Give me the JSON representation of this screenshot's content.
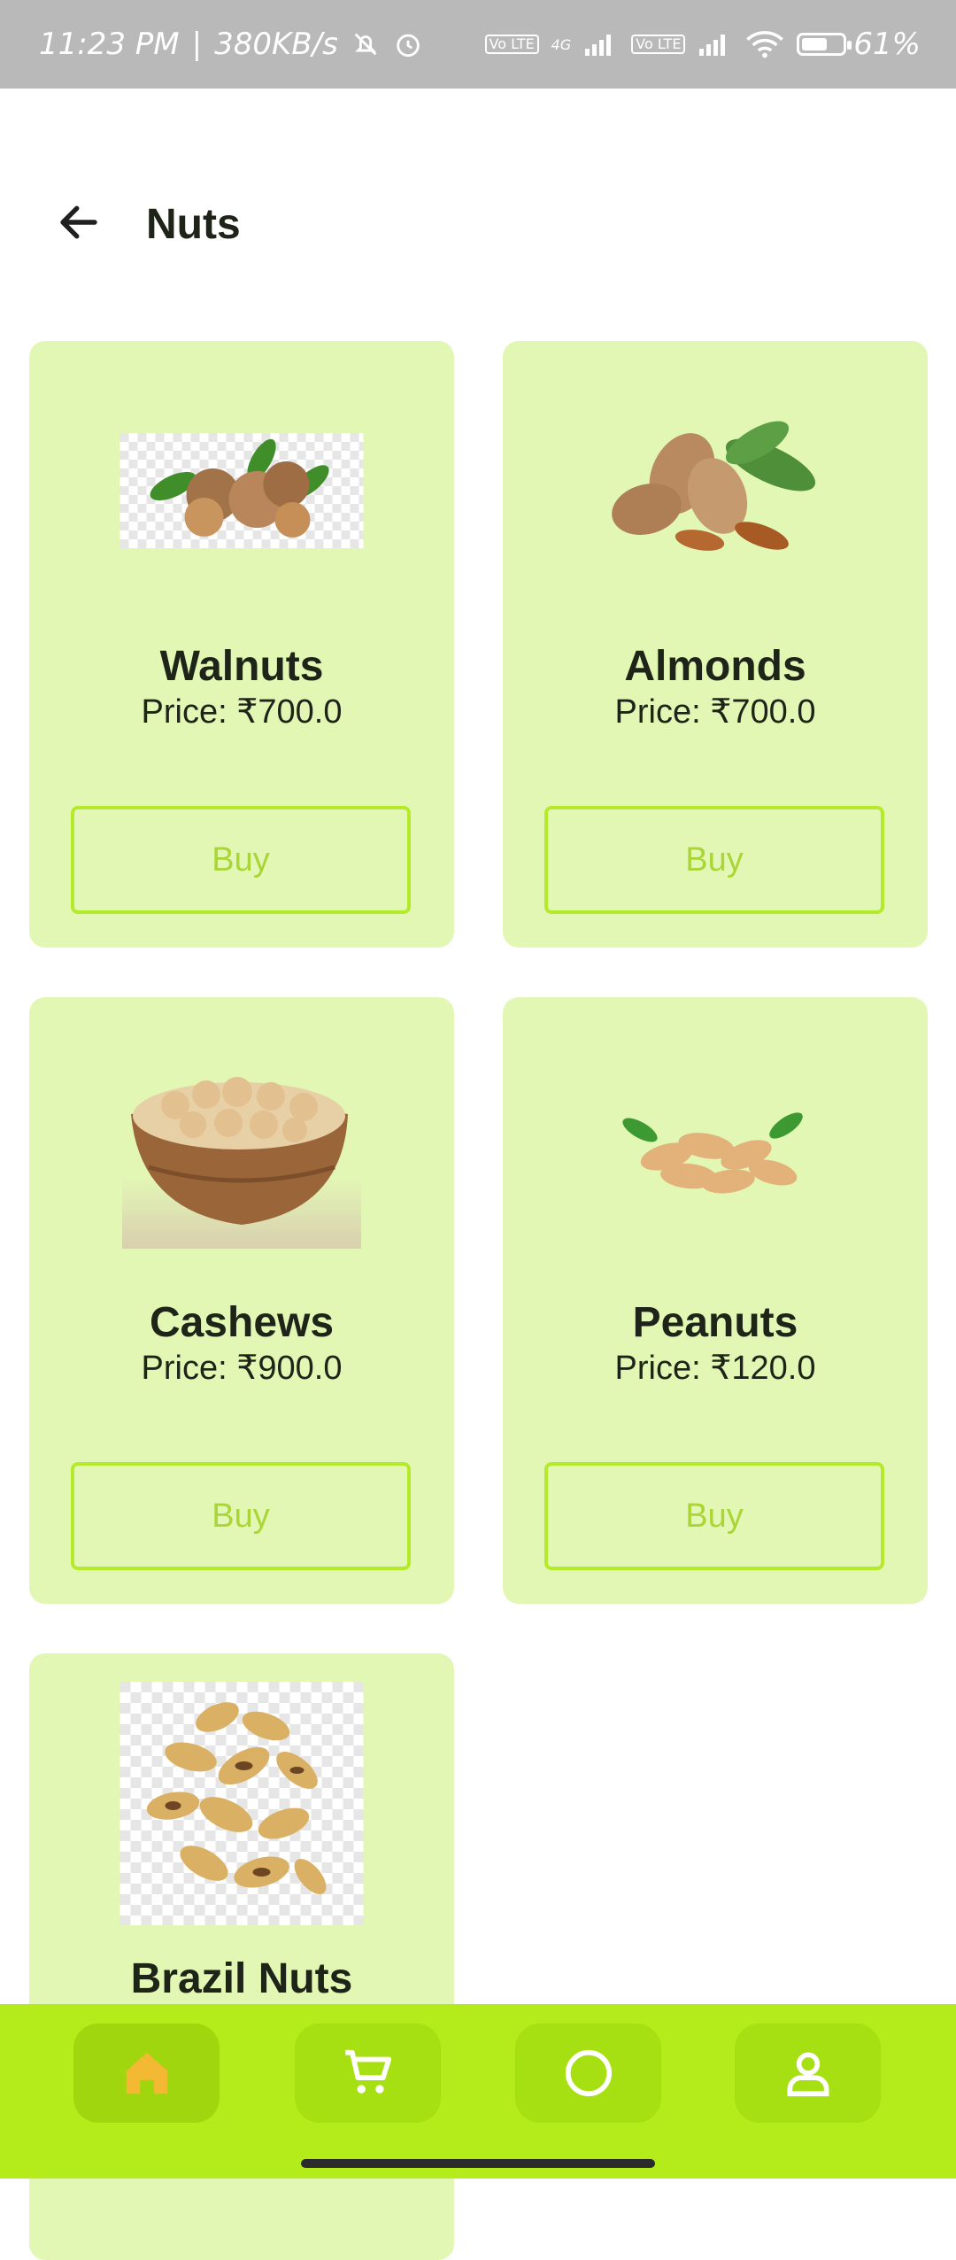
{
  "status": {
    "time": "11:23 PM",
    "speed": "380KB/s",
    "network_label": "4G",
    "volte1": "Vo LTE",
    "volte2": "Vo LTE",
    "battery": "61%"
  },
  "header": {
    "title": "Nuts"
  },
  "products": [
    {
      "name": "Walnuts",
      "price": "Price: ₹700.0",
      "buy_label": "Buy"
    },
    {
      "name": "Almonds",
      "price": "Price: ₹700.0",
      "buy_label": "Buy"
    },
    {
      "name": "Cashews",
      "price": "Price: ₹900.0",
      "buy_label": "Buy"
    },
    {
      "name": "Peanuts",
      "price": "Price: ₹120.0",
      "buy_label": "Buy"
    },
    {
      "name": "Brazil Nuts",
      "price": "",
      "buy_label": ""
    }
  ],
  "nav": {
    "items": [
      {
        "icon": "home-icon",
        "active": true
      },
      {
        "icon": "cart-icon",
        "active": false
      },
      {
        "icon": "circle-icon",
        "active": false
      },
      {
        "icon": "profile-icon",
        "active": false
      }
    ]
  },
  "colors": {
    "card_bg": "#e3f7b5",
    "accent": "#b5ea2b",
    "nav_bg": "#b3ec1a",
    "home_icon": "#f4b933"
  }
}
